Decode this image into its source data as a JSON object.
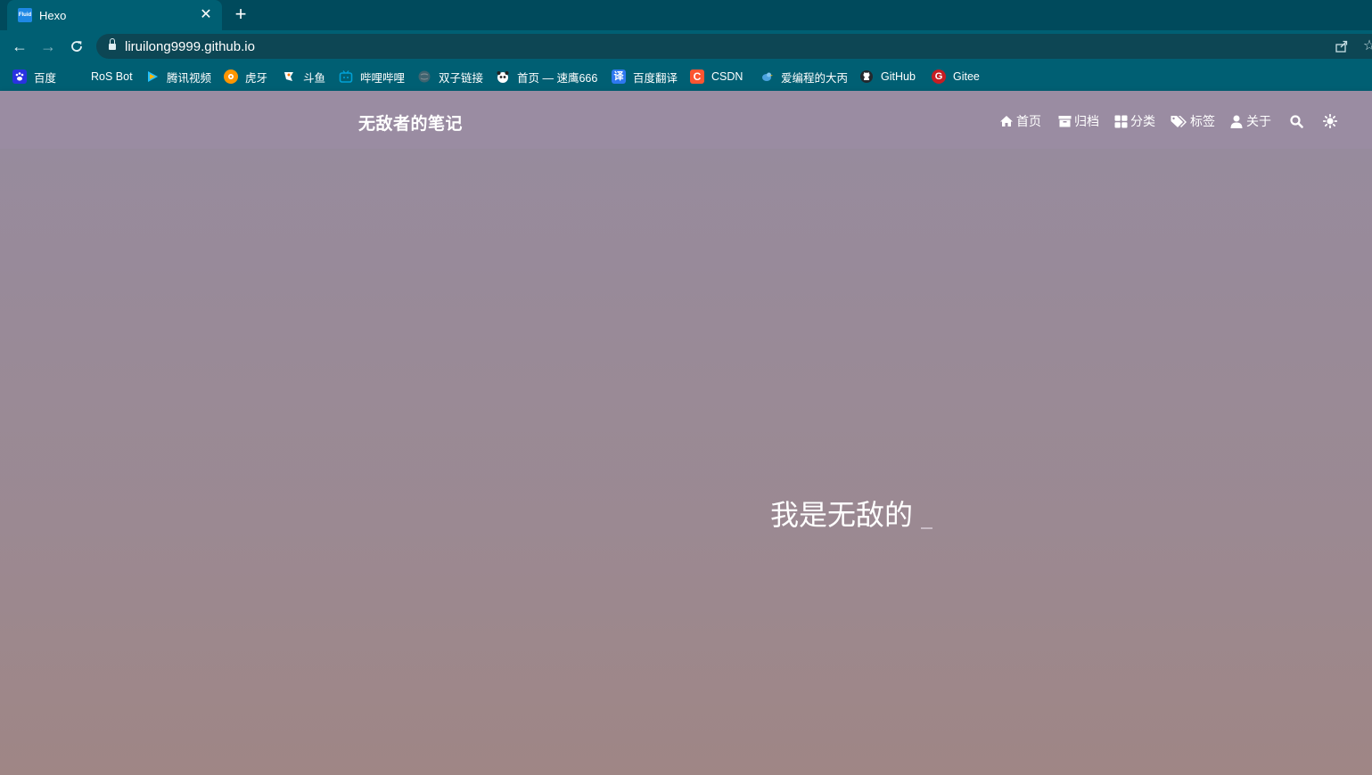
{
  "browser": {
    "tab": {
      "title": "Hexo",
      "favicon_text": "Fluid"
    },
    "url": "liruilong9999.github.io",
    "bookmarks": [
      {
        "label": "百度",
        "icon": "baidu-paw-icon",
        "color": "#2932e1"
      },
      {
        "label": "RoS Bot",
        "icon": "",
        "color": ""
      },
      {
        "label": "腾讯视频",
        "icon": "tencent-video-icon",
        "color": "#22c1ff"
      },
      {
        "label": "虎牙",
        "icon": "huya-icon",
        "color": "#ff9600"
      },
      {
        "label": "斗鱼",
        "icon": "douyu-icon",
        "color": "#ff7700"
      },
      {
        "label": "哔哩哔哩",
        "icon": "bilibili-icon",
        "color": "#00a1d6"
      },
      {
        "label": "双子链接",
        "icon": "globe-icon",
        "color": "#7d8b91"
      },
      {
        "label": "首页 — 速鹰666",
        "icon": "panda-icon",
        "color": "#333333"
      },
      {
        "label": "百度翻译",
        "icon": "baidu-translate-icon",
        "color": "#2e78f0"
      },
      {
        "label": "CSDN",
        "icon": "csdn-icon",
        "color": "#fc5531"
      },
      {
        "label": "爱编程的大丙",
        "icon": "bird-icon",
        "color": "#4aa3df"
      },
      {
        "label": "GitHub",
        "icon": "github-icon",
        "color": "#24292e"
      },
      {
        "label": "Gitee",
        "icon": "gitee-icon",
        "color": "#c71d23"
      }
    ]
  },
  "site": {
    "brand": "无敌者的笔记",
    "nav": [
      {
        "label": "首页",
        "icon": "home-icon"
      },
      {
        "label": "归档",
        "icon": "archive-icon"
      },
      {
        "label": "分类",
        "icon": "categories-icon"
      },
      {
        "label": "标签",
        "icon": "tags-icon"
      },
      {
        "label": "关于",
        "icon": "user-icon"
      }
    ],
    "search_icon": "search-icon",
    "theme_icon": "sun-icon",
    "hero_subtitle": "我是无敌的"
  }
}
